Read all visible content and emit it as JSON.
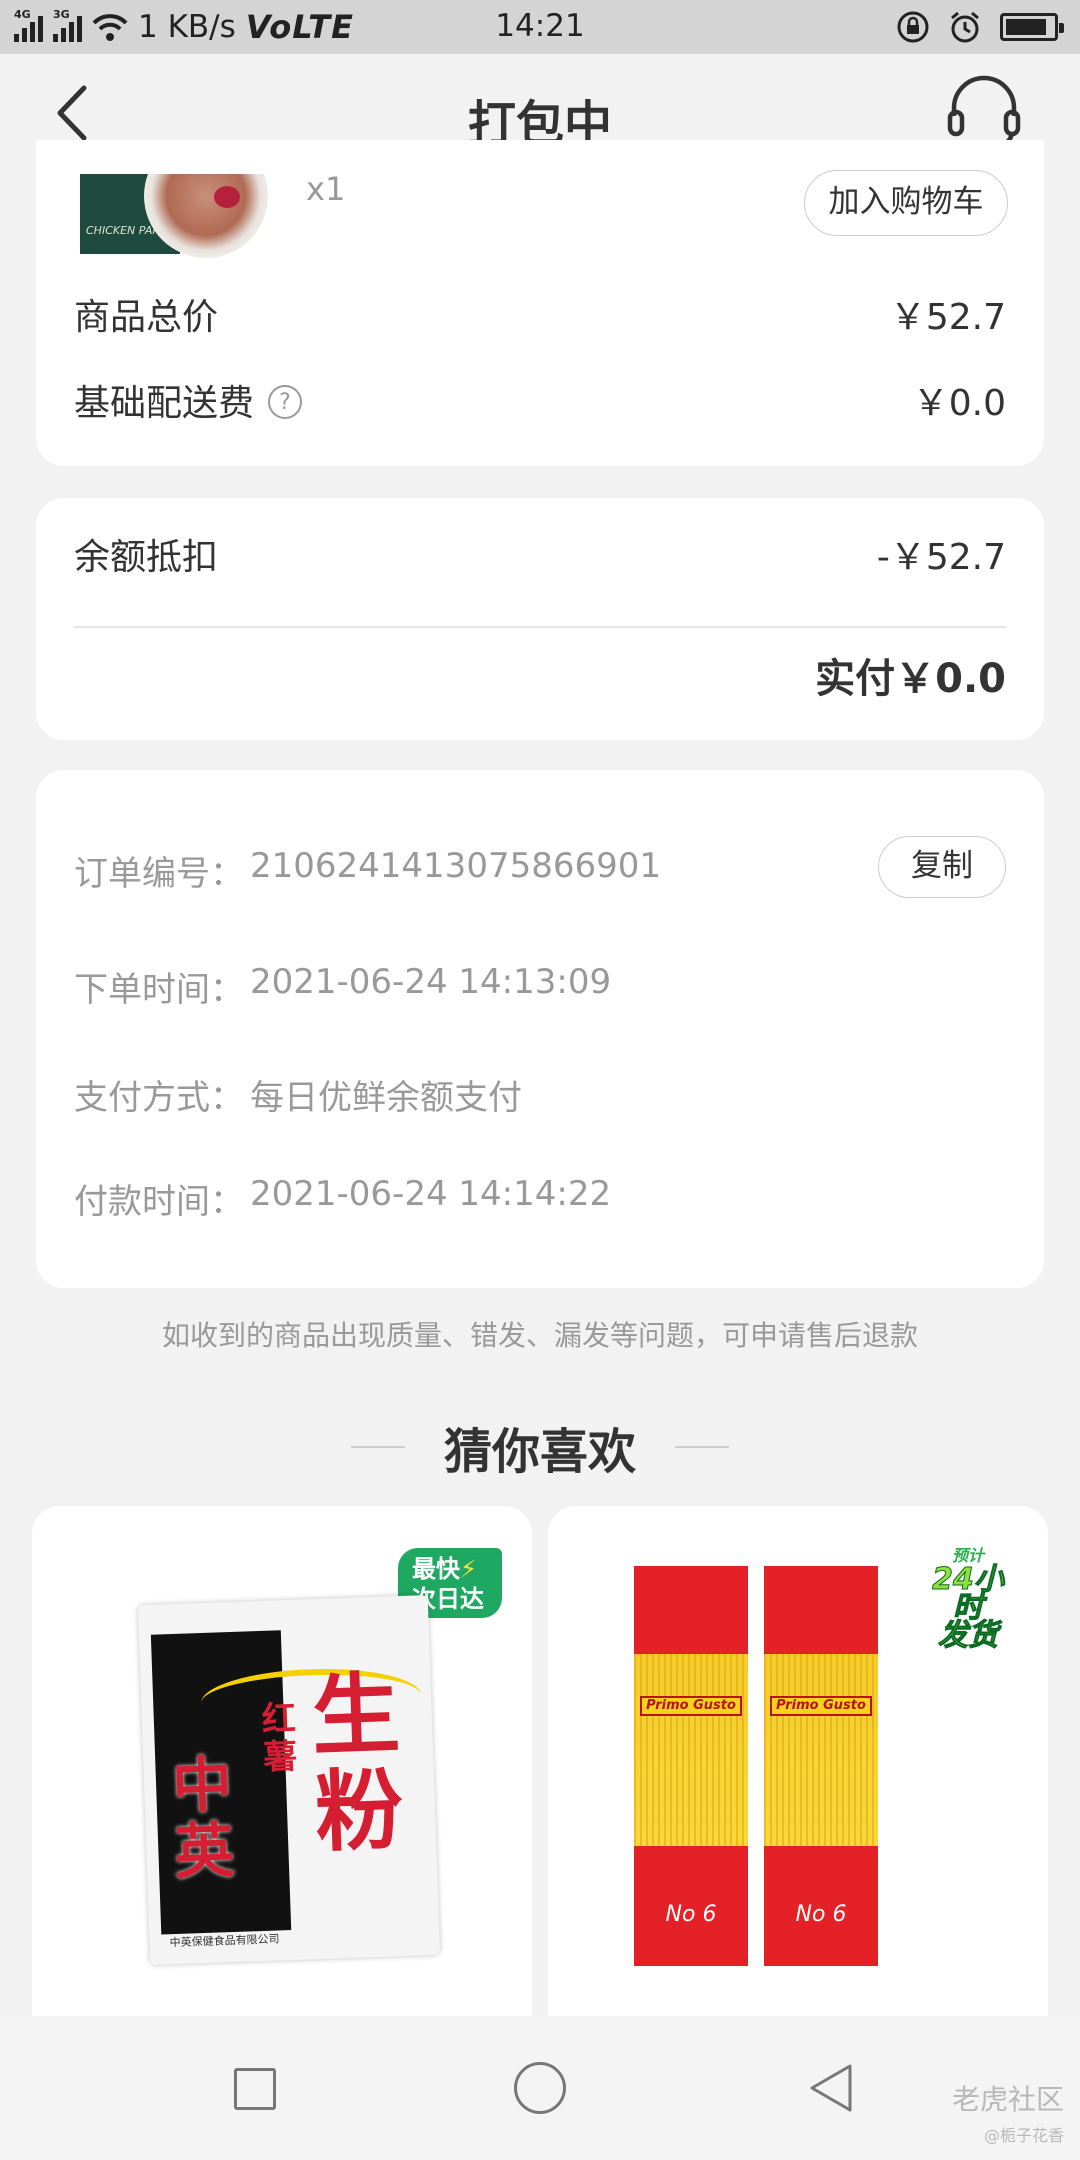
{
  "status_bar": {
    "network_1": "4G",
    "network_2": "3G",
    "speed": "1 KB/s",
    "volte": "VoLTE",
    "time": "14:21"
  },
  "header": {
    "title": "打包中"
  },
  "item": {
    "quantity": "x1",
    "add_to_cart_label": "加入购物车",
    "image_text": "CHICKEN PAR"
  },
  "price": {
    "total_label": "商品总价",
    "total_value": "￥52.7",
    "delivery_label": "基础配送费",
    "delivery_value": "￥0.0",
    "help_glyph": "?"
  },
  "payment": {
    "balance_label": "余额抵扣",
    "balance_value": "-￥52.7",
    "paid_text": "实付￥0.0"
  },
  "order_info": {
    "copy_label": "复制",
    "rows": [
      {
        "label": "订单编号：",
        "value": "2106241413075866901"
      },
      {
        "label": "下单时间：",
        "value": "2021-06-24 14:13:09"
      },
      {
        "label": "支付方式：",
        "value": "每日优鲜余额支付"
      },
      {
        "label": "付款时间：",
        "value": "2021-06-24 14:14:22"
      }
    ]
  },
  "notice": "如收到的商品出现质量、错发、漏发等问题，可申请售后退款",
  "recommend": {
    "title": "猜你喜欢",
    "products": [
      {
        "badge_line1": "最快",
        "badge_bolt": "⚡",
        "badge_line2": "次日达",
        "brand": "中英",
        "label_small": "红薯",
        "label_big": "生粉",
        "footer": "中英保健食品有限公司"
      },
      {
        "badge_top": "预计",
        "badge_line1": "24小时",
        "badge_line2": "发货",
        "label": "Primo Gusto",
        "number": "No 6"
      }
    ]
  },
  "watermark": {
    "main": "老虎社区",
    "sub": "@栀子花香"
  }
}
